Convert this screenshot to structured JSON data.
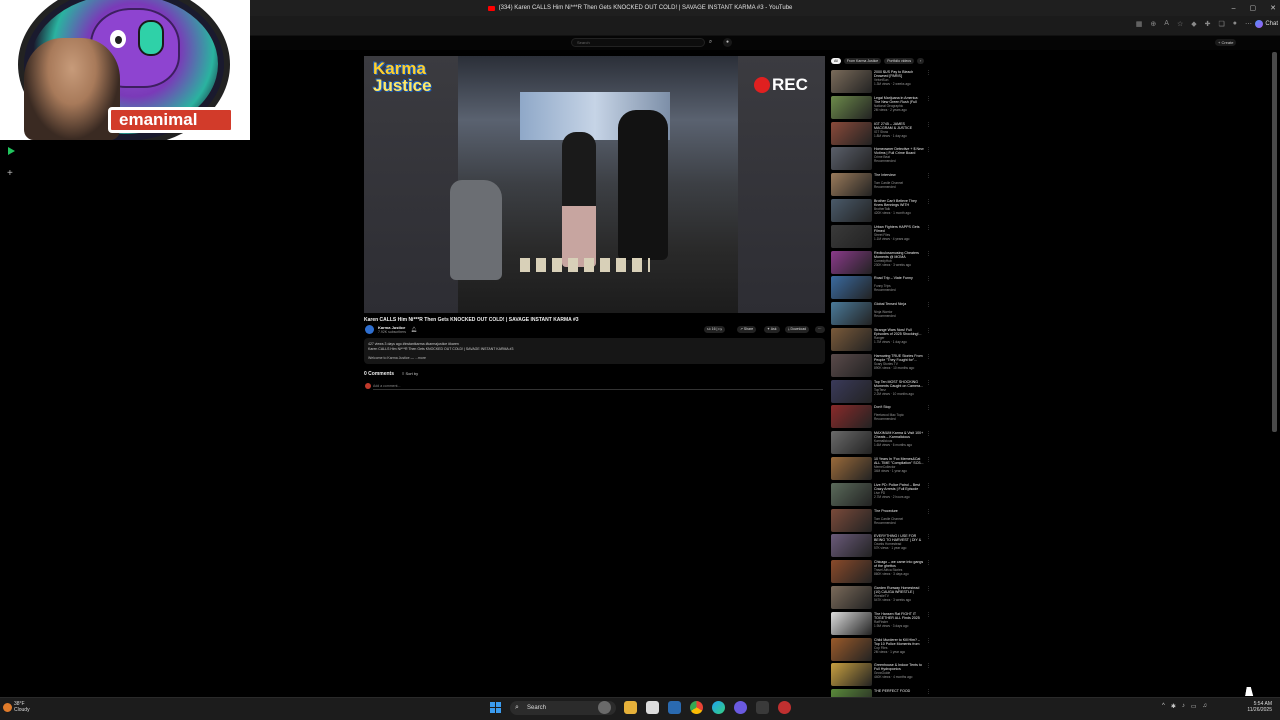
{
  "window": {
    "title": "(334) Karen CALLS Him Ni***R Then Gets KNOCKED OUT COLD! | SAVAGE INSTANT KARMA #3 - YouTube",
    "controls": [
      "–",
      "▢",
      "✕"
    ]
  },
  "browser": {
    "chat_label": "Chat"
  },
  "youtube": {
    "search_placeholder": "Search",
    "create_label": "+ Create",
    "search_icon": "search-icon",
    "mic_icon": "mic-icon"
  },
  "overlay": {
    "banner_text": "emanimal",
    "watermark_top": "Karma",
    "watermark_bottom": "Justice",
    "rec_label": "REC"
  },
  "video": {
    "title": "Karen CALLS Him Ni***R Then Gets KNOCKED OUT COLD! | SAVAGE INSTANT KARMA #3",
    "channel": "Karma Justice",
    "subscribers": "7.92K subscribers",
    "likes": "16",
    "share_label": "Share",
    "ask_label": "Ask",
    "download_label": "Download",
    "description_line1": "427 views  3 days ago  #instantkarma #karmajustice #karen",
    "description_line2": "Karen CALLS Him Ni***R Then Gets KNOCKED OUT COLD! | SAVAGE INSTANT KARMA #3",
    "description_line3": "Welcome to Karma Justice — ...more",
    "comments_count": "0 Comments",
    "sort_label": "Sort by",
    "add_comment_placeholder": "Add a comment..."
  },
  "sidebar": {
    "chips": [
      {
        "label": "All",
        "selected": true
      },
      {
        "label": "From Karma Justice",
        "selected": false
      },
      {
        "label": "Portfolio videos",
        "selected": false
      }
    ],
    "recommendations": [
      {
        "title": "2000 $US Pay to Bleach Drowned [PARIS] COMPETITION",
        "channel": "VelvetSun",
        "meta": "1.3M views · 2 weeks ago",
        "thumb": "#7a6b5a"
      },
      {
        "title": "Legal Marijuana in America: The New Green Rush (Full Episode)",
        "channel": "National Geographic",
        "meta": "2M views · 2 years ago",
        "thumb": "#6c8a4a"
      },
      {
        "title": "IGT 2745 – JAMES MACGRAM & JUSTICE",
        "channel": "IGT Show",
        "meta": "1.8M views · 1 day ago",
        "thumb": "#8a4a3a"
      },
      {
        "title": "Homeowner Detective + $ New Victims | Full Crime Board",
        "channel": "Crime Beat",
        "meta": "Recommended",
        "thumb": "#5a5f6a"
      },
      {
        "title": "The Interview",
        "channel": "Tom Cardle Channel",
        "meta": "Recommended",
        "thumb": "#9a7a5a"
      },
      {
        "title": "Brother Can't Believe They Knew Bennings WITH Measured | Till It...",
        "channel": "BrotherTalk",
        "meta": "420K views · 1 month ago",
        "thumb": "#4a5a6a"
      },
      {
        "title": "Urban Fighters HAPPS Gets Filmed",
        "channel": "Street Files",
        "meta": "1.1M views · 4 years ago",
        "thumb": "#3a3a3a"
      },
      {
        "title": "Rediculosamusing Cheaters Moments @ MOMA",
        "channel": "ComedyHub",
        "meta": "230K views · 3 weeks ago",
        "thumb": "#8a3a8a"
      },
      {
        "title": "Road Trip – Vlate Funny",
        "channel": "Funny Trips",
        "meta": "Recommended",
        "thumb": "#3a6aa0"
      },
      {
        "title": "Global Tensed Ninja",
        "channel": "Ninja Warrior",
        "meta": "Recommended",
        "thumb": "#4a7a9a"
      },
      {
        "title": "Strange Wars Now! Full Episodes of 2025 Shocking!...",
        "channel": "Ranger",
        "meta": "1.7M views · 1 day ago",
        "thumb": "#7a5a3a"
      },
      {
        "title": "Harrowing TRUE Stories From People \"They Fought for\"...",
        "channel": "Scary Stories TV",
        "meta": "890K views · 10 months ago",
        "thumb": "#5a4a4a"
      },
      {
        "title": "Top Ten MOST SHOCKING Moments Caught on Camera...",
        "channel": "TopTenz",
        "meta": "2.2M views · 10 months ago",
        "thumb": "#3a3a5a"
      },
      {
        "title": "Don't Stop",
        "channel": "Fleetwood Mac Topic",
        "meta": "Recommended",
        "thumb": "#8a2a2a"
      },
      {
        "title": "MAXIMUM Karma & Visit 100+ Cheats – Karmalicious Moments!...",
        "channel": "Karmalicious",
        "meta": "1.6M views · 6 months ago",
        "thumb": "#6a6a6a"
      },
      {
        "title": "10 Years In 'Fox Memes&Cat ALL TIME \"Compilation\" SO3...",
        "channel": "MemeCollector",
        "meta": "34M views · 1 year ago",
        "thumb": "#9a6a3a"
      },
      {
        "title": "Live PD: Police Patrol – Best Crazy Arrests | Full Episode",
        "channel": "Live PD",
        "meta": "2.7M views · 2 hours ago",
        "thumb": "#5a6a5a"
      },
      {
        "title": "The Procedure",
        "channel": "Tom Cardle Channel",
        "meta": "Recommended",
        "thumb": "#7a4a3a"
      },
      {
        "title": "EVERYTHING I USE FOR BEING TO HARVEST | DIY & GUIDE...",
        "channel": "Ozarks Homestead",
        "meta": "57K views · 1 year ago",
        "thumb": "#6a5a7a"
      },
      {
        "title": "Chicago – we came into gangs of the ghettos",
        "channel": "Travel Africa Stories",
        "meta": "860K views · 3 days ago",
        "thumb": "#8a4a2a"
      },
      {
        "title": "Garden Runway Homestead (10) CAUGA WRESTLE | Ballroom...",
        "channel": "WrestleTV",
        "meta": "547K views · 3 weeks ago",
        "thumb": "#7a6a5a"
      },
      {
        "title": "The Hansen Rat FIGHT IT TOGETHER ALL Finds 2025 Mee...",
        "channel": "RatFinder",
        "meta": "1.9M views · 3 days ago",
        "thumb": "#dcdcdc"
      },
      {
        "title": "Child Murderer to Kill Him? – Top 10 Police Moments from CCP...",
        "channel": "Cop Files",
        "meta": "2M views · 1 year ago",
        "thumb": "#9a5a2a"
      },
      {
        "title": "Greenhouse & Indoor Tents to Full Hydroponics",
        "channel": "GrowGuide",
        "meta": "440K views · 4 months ago",
        "thumb": "#c8a040"
      },
      {
        "title": "THE PERFECT FOOD",
        "channel": "Food Lab",
        "meta": "Recommended",
        "thumb": "#5a8a3a"
      }
    ]
  },
  "taskbar": {
    "temperature": "38°F",
    "weather_text": "Cloudy",
    "search_label": "Search",
    "time": "5:54 AM",
    "date": "11/26/2025"
  }
}
